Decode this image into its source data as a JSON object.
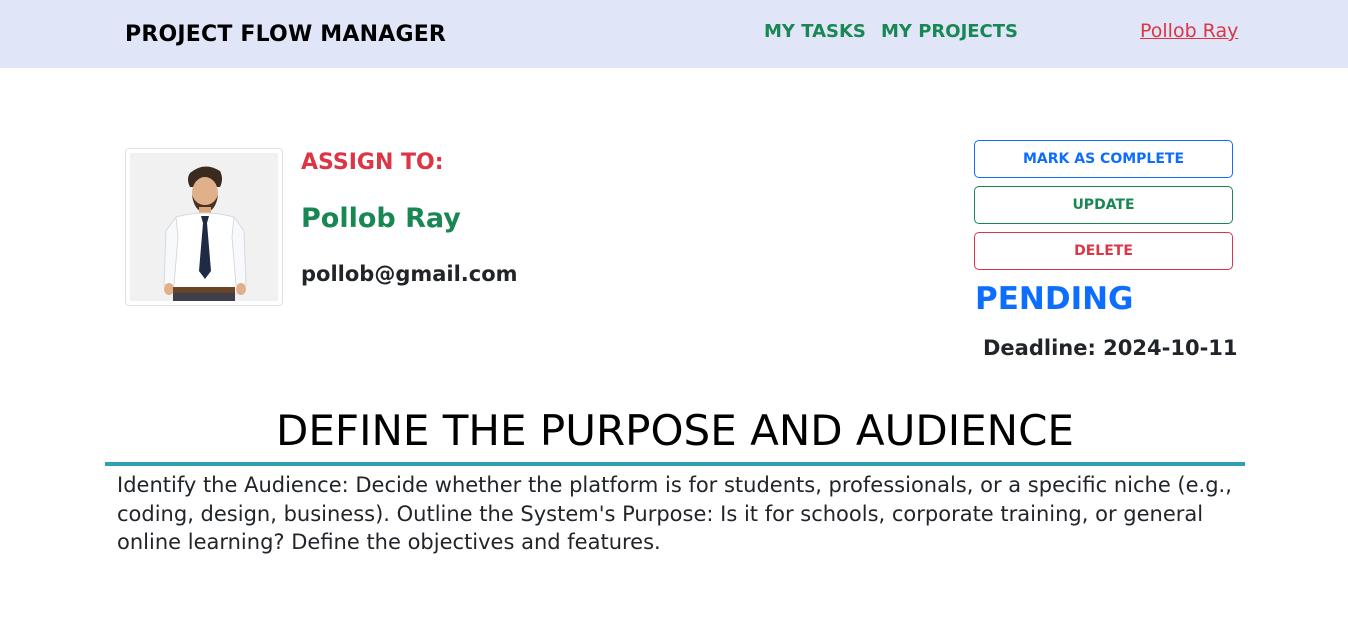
{
  "navbar": {
    "brand": "PROJECT FLOW MANAGER",
    "links": [
      {
        "label": "MY TASKS"
      },
      {
        "label": "MY PROJECTS"
      }
    ],
    "user": "Pollob Ray"
  },
  "assignee": {
    "heading": "ASSIGN TO:",
    "name": "Pollob Ray",
    "email": "pollob@gmail.com",
    "avatar_icon": "user-avatar-icon"
  },
  "actions": {
    "complete_label": "MARK AS COMPLETE",
    "update_label": "UPDATE",
    "delete_label": "DELETE"
  },
  "task": {
    "status": "PENDING",
    "deadline": "Deadline: 2024-10-11",
    "title": "DEFINE THE PURPOSE AND AUDIENCE",
    "description": "Identify the Audience: Decide whether the platform is for students, professionals, or a specific niche (e.g., coding, design, business). Outline the System's Purpose: Is it for schools, corporate training, or general online learning? Define the objectives and features."
  },
  "colors": {
    "navbar_bg": "#e0e6f8",
    "success": "#198754",
    "danger": "#dc3545",
    "primary": "#0d6efd",
    "title_rule": "#2f9fb5"
  }
}
